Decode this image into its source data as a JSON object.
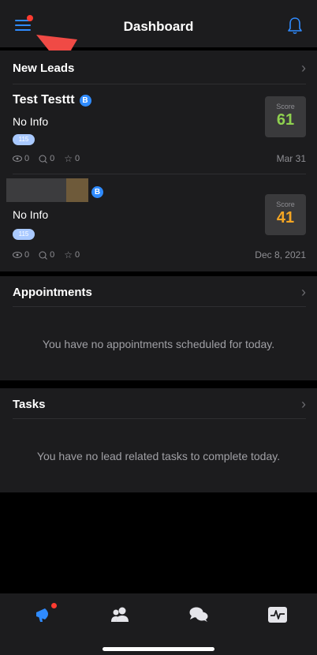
{
  "header": {
    "title": "Dashboard"
  },
  "new_leads": {
    "title": "New Leads",
    "leads": [
      {
        "name": "Test Testtt",
        "badge": "B",
        "info": "No Info",
        "tag": "115",
        "views": "0",
        "comments": "0",
        "stars": "0",
        "date": "Mar 31",
        "score_label": "Score",
        "score": "61",
        "score_color": "#8fd14f"
      },
      {
        "name": "",
        "badge": "B",
        "info": "No Info",
        "tag": "115",
        "views": "0",
        "comments": "0",
        "stars": "0",
        "date": "Dec 8, 2021",
        "score_label": "Score",
        "score": "41",
        "score_color": "#f5a623"
      }
    ]
  },
  "appointments": {
    "title": "Appointments",
    "empty": "You have no appointments scheduled for today."
  },
  "tasks": {
    "title": "Tasks",
    "empty": "You have no lead related tasks to complete today."
  },
  "colors": {
    "accent": "#2f8bff",
    "notification": "#ff3b30",
    "annotation_arrow": "#f04a45"
  }
}
